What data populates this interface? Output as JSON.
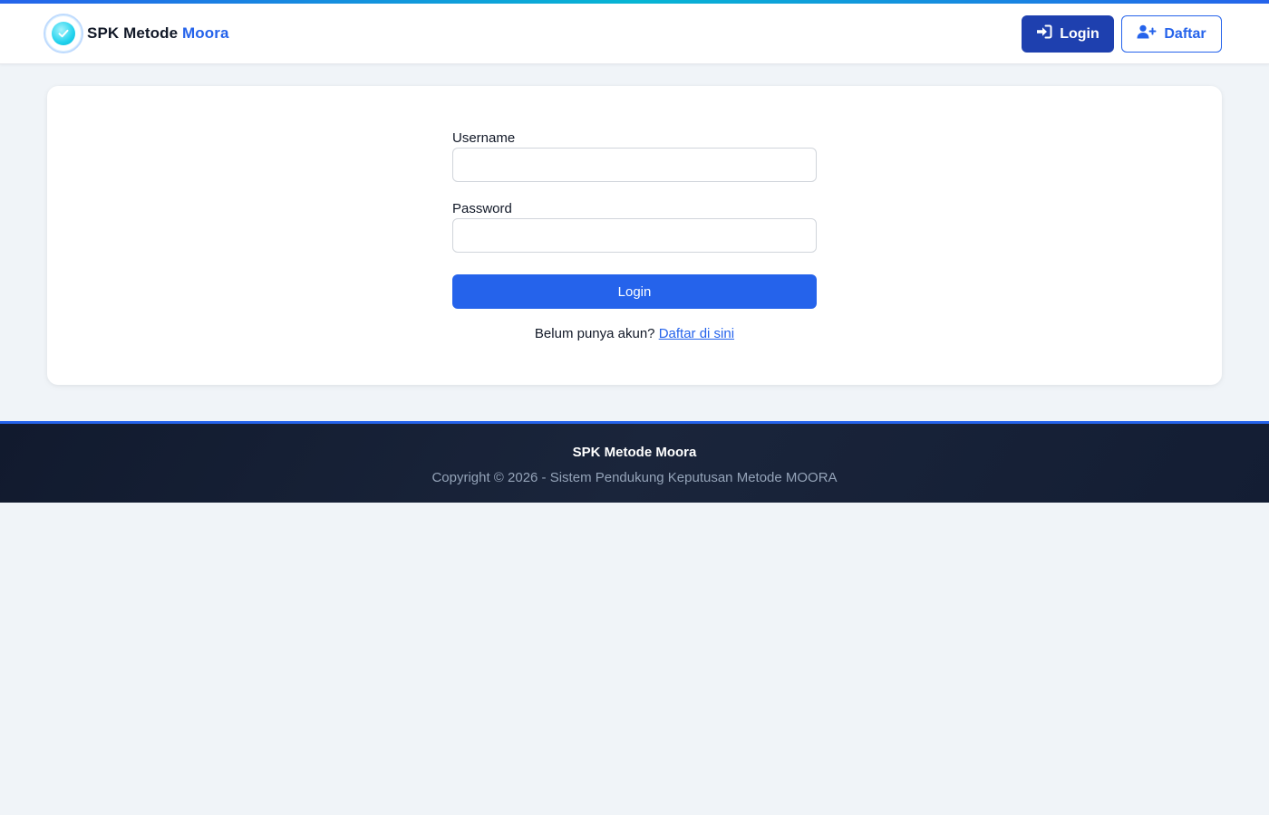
{
  "navbar": {
    "brand_main": "SPK Metode",
    "brand_accent": "Moora",
    "login_label": "Login",
    "daftar_label": "Daftar"
  },
  "form": {
    "username_label": "Username",
    "username_value": "",
    "username_placeholder": "",
    "password_label": "Password",
    "password_value": "",
    "password_placeholder": "",
    "submit_label": "Login",
    "register_prompt": "Belum punya akun?",
    "register_link": "Daftar di sini"
  },
  "footer": {
    "title": "SPK Metode Moora",
    "copyright": "Copyright © 2026 - Sistem Pendukung Keputusan Metode MOORA"
  },
  "icons": {
    "logo": "check-circle-icon",
    "login": "sign-in-icon",
    "daftar": "user-plus-icon"
  },
  "colors": {
    "primary": "#2563eb",
    "primary_dark": "#1e40af",
    "footer_bg": "#111a2e",
    "page_bg": "#f0f4f8"
  }
}
